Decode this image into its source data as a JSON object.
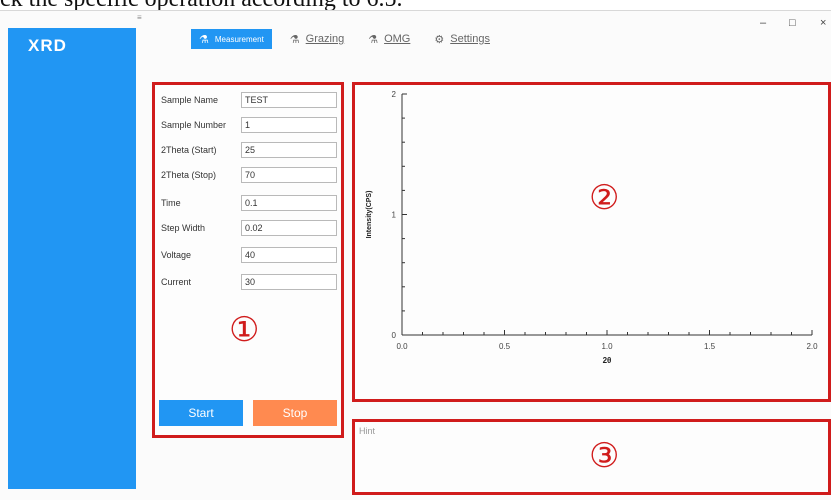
{
  "caption": "ck the specific operation according to 6.5.",
  "app": {
    "title": "XRD",
    "tb_mark": "≡"
  },
  "window_controls": {
    "minimize": "–",
    "maximize": "□",
    "close": "×"
  },
  "tabs": [
    {
      "label": "Measurement",
      "icon": "flask-icon",
      "glyph": "⚗"
    },
    {
      "label": "Grazing",
      "icon": "flask-icon",
      "glyph": "⚗"
    },
    {
      "label": "OMG",
      "icon": "flask-icon",
      "glyph": "⚗"
    },
    {
      "label": "Settings",
      "icon": "gear-icon",
      "glyph": "⚙"
    }
  ],
  "form": {
    "fields": [
      {
        "label": "Sample Name",
        "value": "TEST"
      },
      {
        "label": "Sample Number",
        "value": "1"
      },
      {
        "label": "2Theta (Start)",
        "value": "25"
      },
      {
        "label": "2Theta (Stop)",
        "value": "70"
      },
      {
        "label": "Time",
        "value": "0.1"
      },
      {
        "label": "Step Width",
        "value": "0.02"
      },
      {
        "label": "Voltage",
        "value": "40"
      },
      {
        "label": "Current",
        "value": "30"
      }
    ],
    "start_label": "Start",
    "stop_label": "Stop"
  },
  "annotations": {
    "form_marker": "①",
    "chart_marker": "②",
    "hint_marker": "③"
  },
  "hint": {
    "label": "Hint"
  },
  "colors": {
    "accent": "#2196f3",
    "stop": "#ff8a50",
    "annotation": "#d01c1c"
  },
  "chart_data": {
    "type": "line",
    "series": [],
    "xlabel": "2θ",
    "ylabel": "Intensity(CPS)",
    "xlim": [
      0.0,
      2.0
    ],
    "ylim": [
      0,
      2
    ],
    "xticks": [
      "0.0",
      "0.5",
      "1.0",
      "1.5",
      "2.0"
    ],
    "yticks": [
      "0",
      "1",
      "2"
    ],
    "grid": false
  }
}
